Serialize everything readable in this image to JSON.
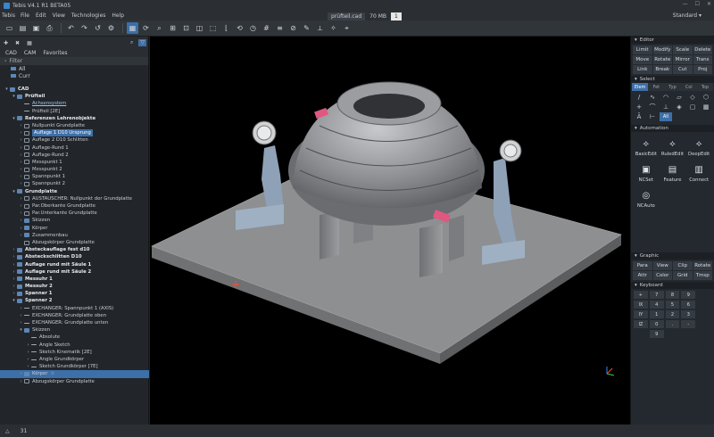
{
  "window": {
    "title": "Tebis V4.1 R1 BETA05"
  },
  "menu": {
    "app": "Tebis",
    "items": [
      "File",
      "Edit",
      "View",
      "Technologies",
      "Help"
    ]
  },
  "doc": {
    "name": "prüfteil.cad",
    "size": "70 MB",
    "page": "1"
  },
  "layout": {
    "value": "Standard"
  },
  "left": {
    "tabs": [
      "CAD",
      "CAM",
      "Favorites"
    ],
    "filter": "Filter",
    "top_items": [
      "All",
      "Curr"
    ],
    "tree": [
      {
        "label": "CAD",
        "level": 0,
        "toggle": "▾",
        "style": "bold",
        "icon": "folder"
      },
      {
        "label": "Prüfteil",
        "level": 1,
        "toggle": "▾",
        "style": "bold",
        "icon": "folder"
      },
      {
        "label": "Achsensystem",
        "level": 2,
        "toggle": "",
        "style": "link",
        "icon": "line"
      },
      {
        "label": "Prüfteil [2E]",
        "level": 2,
        "toggle": "",
        "style": "",
        "icon": "line"
      },
      {
        "label": "Referenzen Lehrenobjekte",
        "level": 1,
        "toggle": "▾",
        "style": "bold",
        "icon": "folder"
      },
      {
        "label": "Nullpunkt Grundplatte",
        "level": 2,
        "toggle": "›",
        "style": "",
        "icon": "box"
      },
      {
        "label": "Auflage 1 D10 Ursprung",
        "level": 2,
        "toggle": "›",
        "style": "hl",
        "icon": "box"
      },
      {
        "label": "Auflage 2 D10 Schlitten",
        "level": 2,
        "toggle": "›",
        "style": "",
        "icon": "box"
      },
      {
        "label": "Auflage-Rund 1",
        "level": 2,
        "toggle": "›",
        "style": "",
        "icon": "box"
      },
      {
        "label": "Auflage-Rund 2",
        "level": 2,
        "toggle": "›",
        "style": "",
        "icon": "box"
      },
      {
        "label": "Messpunkt 1",
        "level": 2,
        "toggle": "›",
        "style": "",
        "icon": "box"
      },
      {
        "label": "Messpunkt 2",
        "level": 2,
        "toggle": "›",
        "style": "",
        "icon": "box"
      },
      {
        "label": "Spannpunkt 1",
        "level": 2,
        "toggle": "›",
        "style": "",
        "icon": "box"
      },
      {
        "label": "Spannpunkt 2",
        "level": 2,
        "toggle": "›",
        "style": "",
        "icon": "box"
      },
      {
        "label": "Grundplatte",
        "level": 1,
        "toggle": "▾",
        "style": "bold",
        "icon": "folder"
      },
      {
        "label": "AUSTAUSCHER: Nullpunkt der Grundplatte",
        "level": 2,
        "toggle": "›",
        "style": "",
        "icon": "box"
      },
      {
        "label": "Par.Oberkante Grundplatte",
        "level": 2,
        "toggle": "›",
        "style": "",
        "icon": "box"
      },
      {
        "label": "Par.Unterkante Grundplatte",
        "level": 2,
        "toggle": "›",
        "style": "",
        "icon": "box"
      },
      {
        "label": "Skizzen",
        "level": 2,
        "toggle": "›",
        "style": "",
        "icon": "folder"
      },
      {
        "label": "Körper",
        "level": 2,
        "toggle": "›",
        "style": "",
        "icon": "folder"
      },
      {
        "label": "Zusammenbau",
        "level": 2,
        "toggle": "›",
        "style": "",
        "icon": "folder"
      },
      {
        "label": "Abzugskörper Grundplatte",
        "level": 2,
        "toggle": "",
        "style": "",
        "icon": "box"
      },
      {
        "label": "Absteckauflage fest d10",
        "level": 1,
        "toggle": "›",
        "style": "bold",
        "icon": "folder"
      },
      {
        "label": "Absteckschlitten D10",
        "level": 1,
        "toggle": "›",
        "style": "bold",
        "icon": "folder"
      },
      {
        "label": "Auflage rund mit Säule 1",
        "level": 1,
        "toggle": "›",
        "style": "bold",
        "icon": "folder"
      },
      {
        "label": "Auflage rund mit Säule 2",
        "level": 1,
        "toggle": "›",
        "style": "bold",
        "icon": "folder"
      },
      {
        "label": "Messuhr 1",
        "level": 1,
        "toggle": "›",
        "style": "bold",
        "icon": "folder"
      },
      {
        "label": "Messuhr 2",
        "level": 1,
        "toggle": "›",
        "style": "bold",
        "icon": "folder"
      },
      {
        "label": "Spanner 1",
        "level": 1,
        "toggle": "›",
        "style": "bold",
        "icon": "folder"
      },
      {
        "label": "Spanner 2",
        "level": 1,
        "toggle": "▾",
        "style": "bold",
        "icon": "folder"
      },
      {
        "label": "EXCHANGER: Spannpunkt 1 (AXIS)",
        "level": 2,
        "toggle": "›",
        "style": "",
        "icon": "line"
      },
      {
        "label": "EXCHANGER: Grundplatte oben",
        "level": 2,
        "toggle": "›",
        "style": "",
        "icon": "line"
      },
      {
        "label": "EXCHANGER: Grundplatte unten",
        "level": 2,
        "toggle": "›",
        "style": "",
        "icon": "line"
      },
      {
        "label": "Skizzen",
        "level": 2,
        "toggle": "▾",
        "style": "",
        "icon": "folder"
      },
      {
        "label": "Absolute",
        "level": 3,
        "toggle": "",
        "style": "",
        "icon": "line"
      },
      {
        "label": "Angle Sketch",
        "level": 3,
        "toggle": "›",
        "style": "",
        "icon": "line"
      },
      {
        "label": "Sketch Kinematik [2E]",
        "level": 3,
        "toggle": "›",
        "style": "",
        "icon": "line"
      },
      {
        "label": "Angle Grundkörper",
        "level": 3,
        "toggle": "›",
        "style": "",
        "icon": "line"
      },
      {
        "label": "Sketch Grundkörper [7E]",
        "level": 3,
        "toggle": "›",
        "style": "",
        "icon": "line"
      },
      {
        "label": "Körper",
        "level": 2,
        "toggle": "›",
        "style": "sel",
        "icon": "folder"
      },
      {
        "label": "Abzugskörper Grundplatte",
        "level": 2,
        "toggle": "›",
        "style": "",
        "icon": "box"
      }
    ]
  },
  "status": {
    "count": "31"
  },
  "right": {
    "editor": {
      "title": "Editor",
      "buttons": [
        "Limit",
        "Modify",
        "Scale",
        "Delete",
        "Move",
        "Rotate",
        "Mirror",
        "Trans",
        "Link",
        "Break",
        "Cut",
        "Proj"
      ]
    },
    "select": {
      "title": "Select",
      "tabs": [
        "Elem",
        "Fet",
        "Typ",
        "Col",
        "Top"
      ],
      "all": "All"
    },
    "automation": {
      "title": "Automation",
      "buttons": [
        "BasicEdit",
        "RuledEdit",
        "DeepEdit",
        "NCSet",
        "Feature",
        "Connect",
        "NCAuto"
      ]
    },
    "graphic": {
      "title": "Graphic",
      "buttons": [
        "Para",
        "View",
        "Clip",
        "Rotate",
        "Attr",
        "Color",
        "Grid",
        "Tmsp"
      ]
    },
    "keyboard": {
      "title": "Keyboard",
      "keys": [
        "+",
        "7",
        "8",
        "9",
        "",
        "IX",
        "4",
        "5",
        "6",
        "",
        "IY",
        "1",
        "2",
        "3",
        "",
        "IZ",
        "0",
        ".",
        "-",
        "",
        "",
        "9",
        "",
        "",
        ""
      ]
    }
  }
}
